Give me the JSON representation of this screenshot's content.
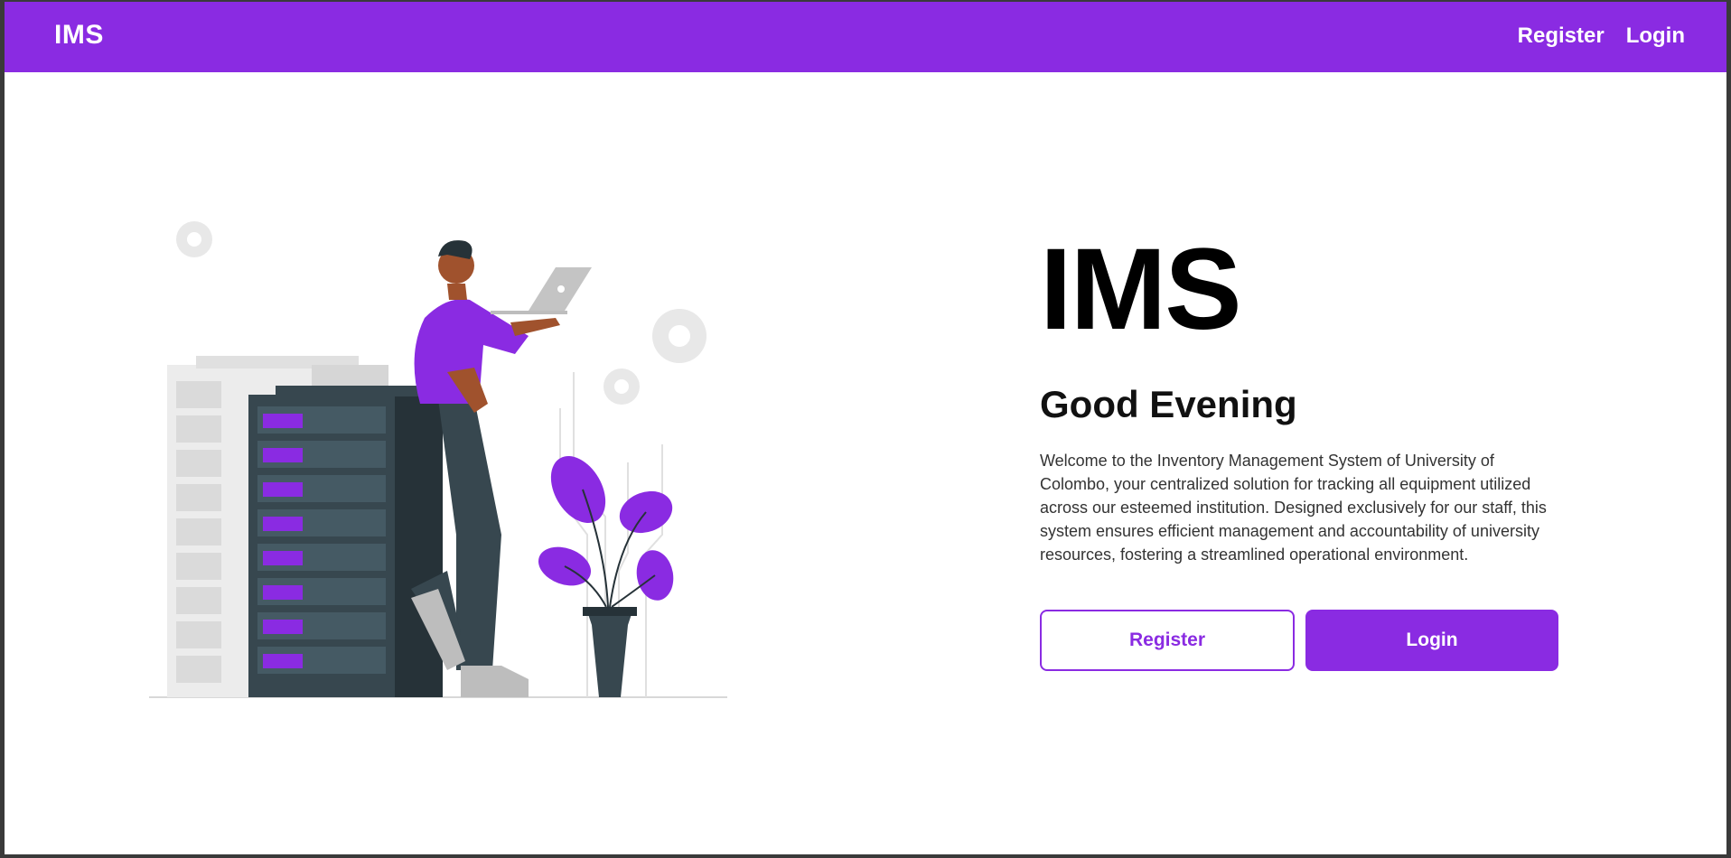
{
  "navbar": {
    "brand": "IMS",
    "links": [
      "Register",
      "Login"
    ]
  },
  "hero": {
    "title": "IMS",
    "greeting": "Good Evening",
    "description": "Welcome to the Inventory Management System of University of Colombo, your centralized solution for tracking all equipment utilized across our esteemed institution. Designed exclusively for our staff, this system ensures efficient management and accountability of university resources, fostering a streamlined operational environment.",
    "register_label": "Register",
    "login_label": "Login"
  },
  "illustration": {
    "icon": "server-room-illustration"
  },
  "colors": {
    "accent": "#8a2be2",
    "dark": "#37474f",
    "light_gray": "#e6e6e6"
  }
}
